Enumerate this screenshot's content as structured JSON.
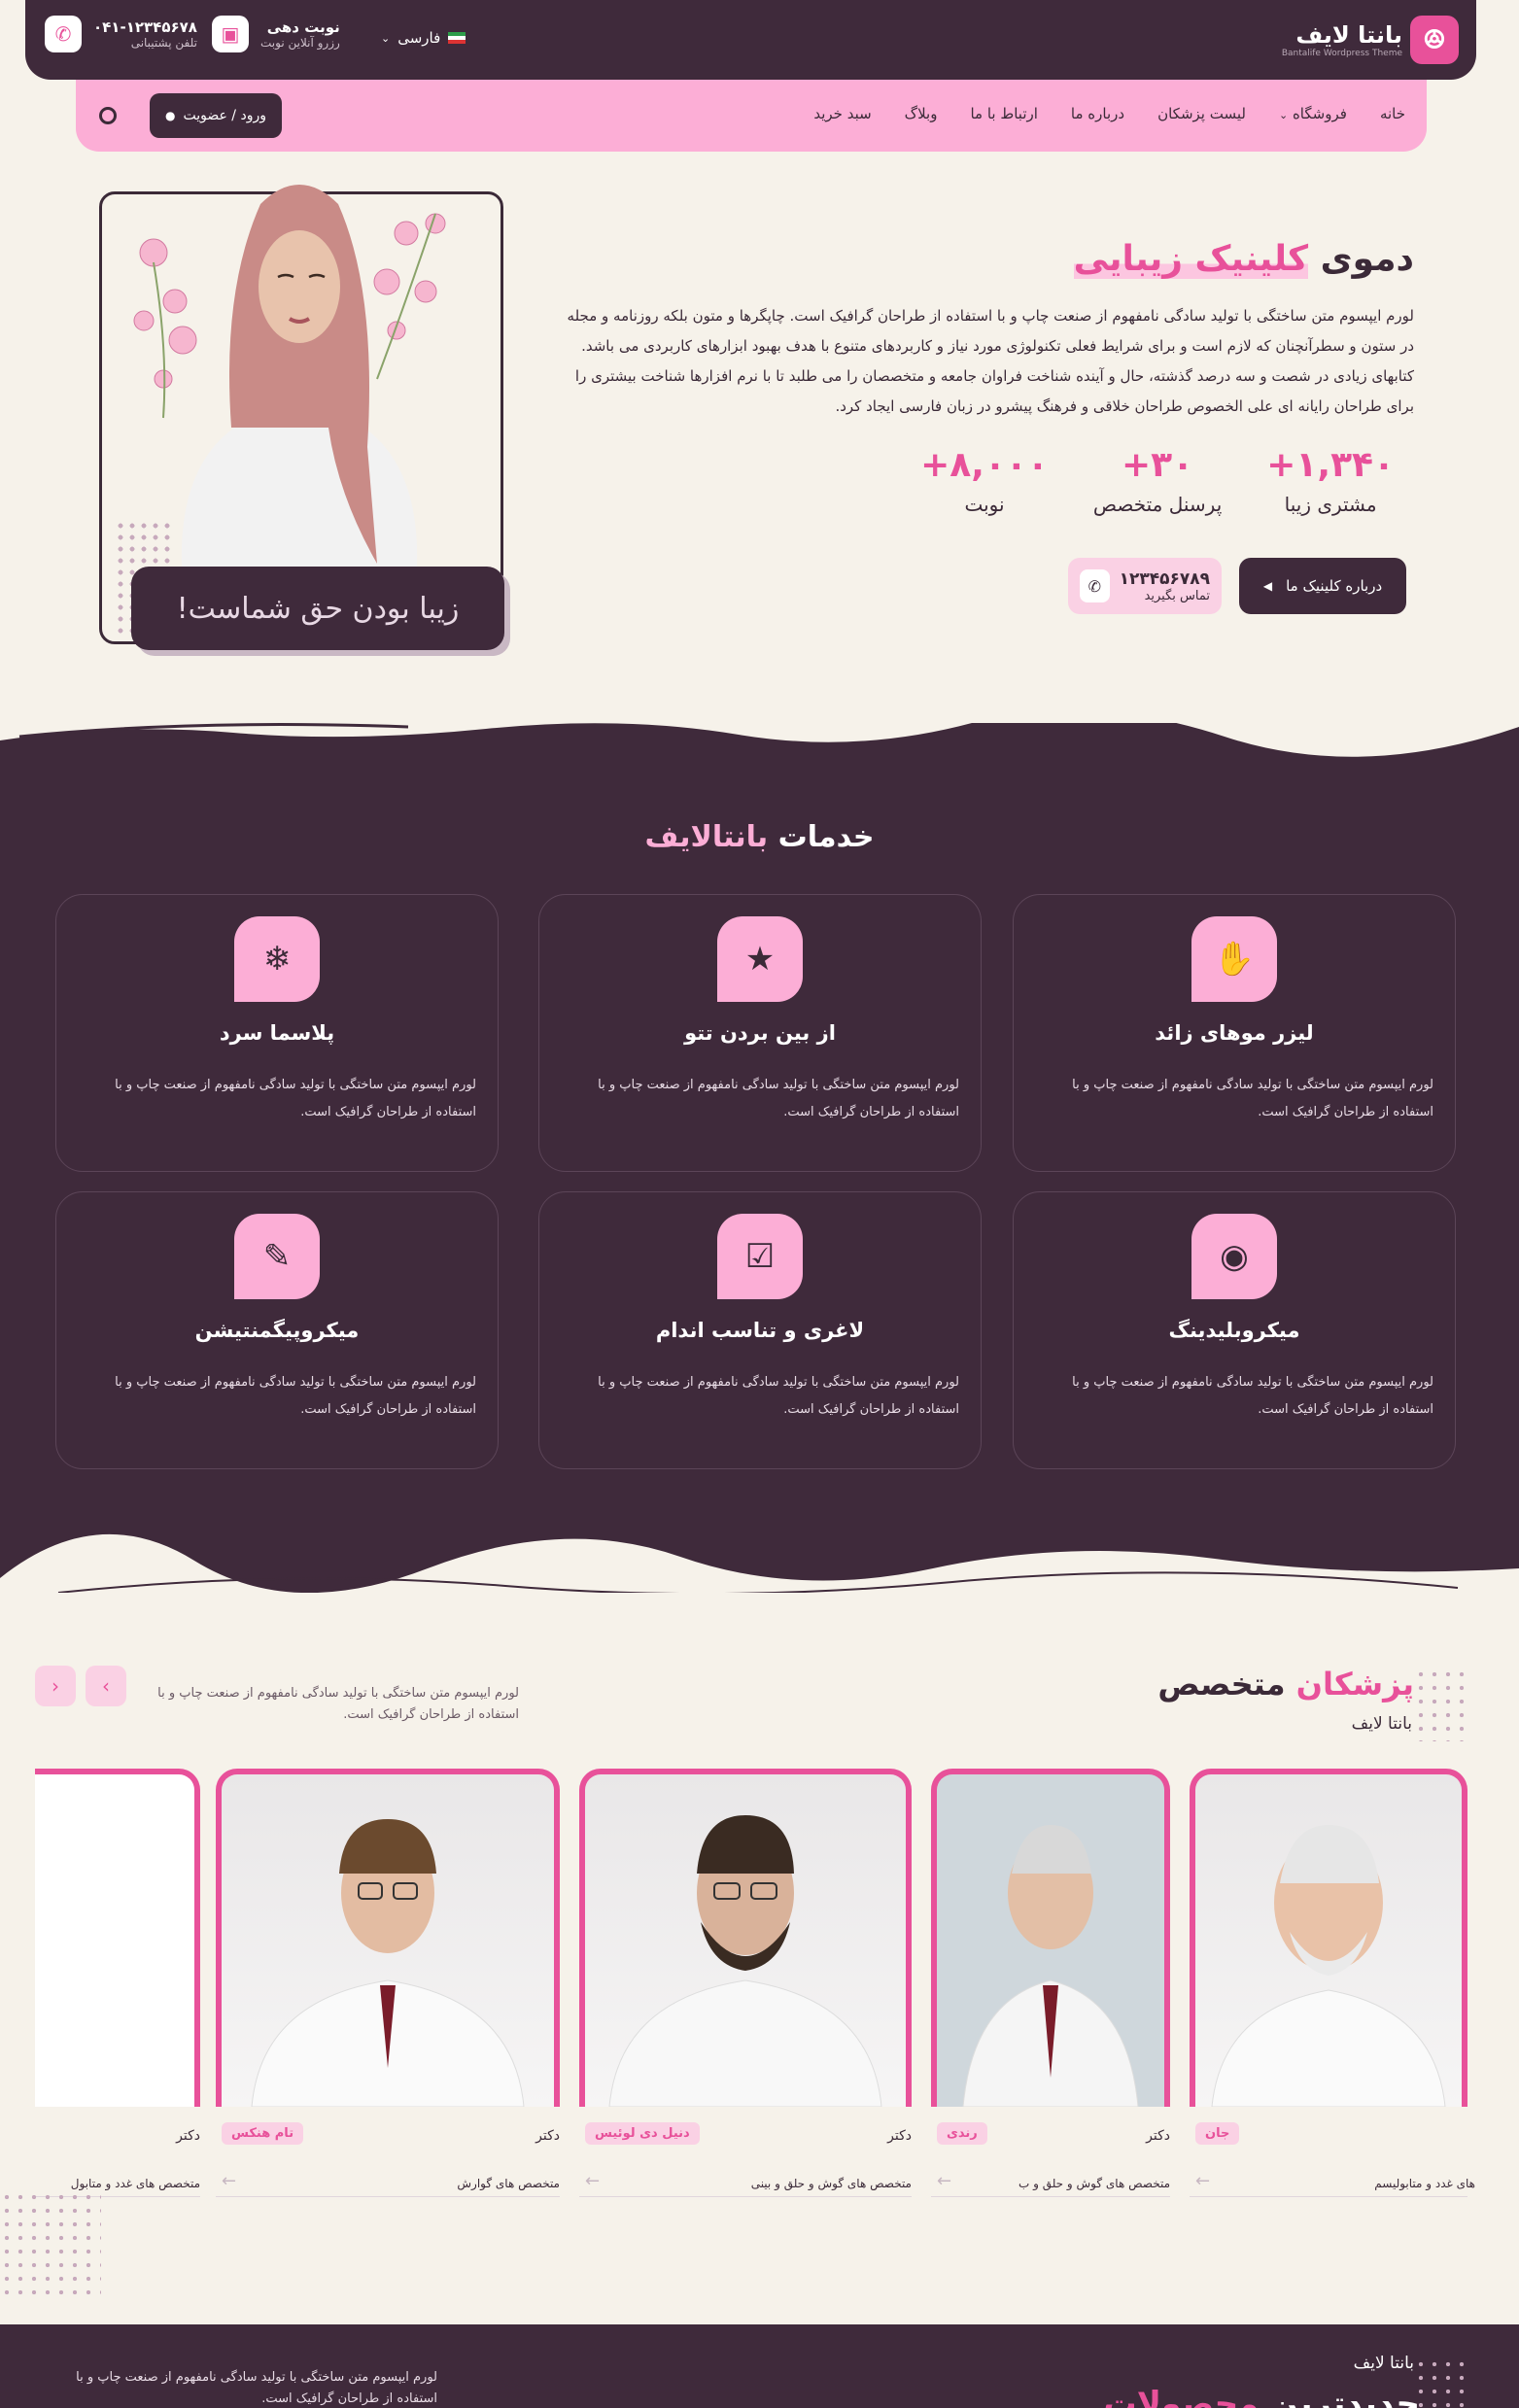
{
  "brand": {
    "name": "بانتا لایف",
    "tagline": "Bantalife Wordpress Theme",
    "accent": "#e8519a",
    "dark": "#3f2a3b",
    "pink": "#fcaed6"
  },
  "topbar": {
    "language": "فارسی",
    "booking": {
      "title": "نوبت دهی",
      "subtitle": "رزرو آنلاین نوبت"
    },
    "support": {
      "phone": "۰۴۱-۱۲۳۴۵۶۷۸",
      "subtitle": "تلفن پشتیبانی"
    }
  },
  "nav": {
    "items": [
      "خانه",
      "فروشگاه",
      "لیست پزشکان",
      "درباره ما",
      "ارتباط با ما",
      "وبلاگ",
      "سبد خرید"
    ],
    "login": "ورود / عضویت"
  },
  "hero": {
    "title_prefix": "دموی",
    "title_highlight": "کلینیک زیبایی",
    "text": "لورم ایپسوم متن ساختگی با تولید سادگی نامفهوم از صنعت چاپ و با استفاده از طراحان گرافیک است. چاپگرها و متون بلکه روزنامه و مجله در ستون و سطرآنچنان که لازم است و برای شرایط فعلی تکنولوژی مورد نیاز و کاربردهای متنوع با هدف بهبود ابزارهای کاربردی می باشد. کتابهای زیادی در شصت و سه درصد گذشته، حال و آینده شناخت فراوان جامعه و متخصصان را می طلبد تا با نرم افزارها شناخت بیشتری را برای طراحان رایانه ای علی الخصوص طراحان خلاقی و فرهنگ پیشرو در زبان فارسی ایجاد کرد.",
    "stats": [
      {
        "num": "+۱,۳۴۰",
        "label": "مشتری زیبا"
      },
      {
        "num": "+۳۰",
        "label": "پرسنل متخصص"
      },
      {
        "num": "+۸,۰۰۰",
        "label": "نوبت"
      }
    ],
    "about_button": "درباره کلینیک ما",
    "call": {
      "number": "۱۲۳۴۵۶۷۸۹",
      "label": "تماس بگیرید"
    },
    "image_caption": "زیبا بودن حق شماست!"
  },
  "services": {
    "title_prefix": "خدمات",
    "title_highlight": "بانتالایف",
    "items": [
      {
        "title": "لیزر موهای زائد",
        "icon": "hand-sparkle-icon",
        "desc": "لورم ایپسوم متن ساختگی با تولید سادگی نامفهوم از صنعت چاپ و با استفاده از طراحان گرافیک است."
      },
      {
        "title": "از بین بردن تتو",
        "icon": "star-icon",
        "desc": "لورم ایپسوم متن ساختگی با تولید سادگی نامفهوم از صنعت چاپ و با استفاده از طراحان گرافیک است."
      },
      {
        "title": "پلاسما سرد",
        "icon": "snowflake-icon",
        "desc": "لورم ایپسوم متن ساختگی با تولید سادگی نامفهوم از صنعت چاپ و با استفاده از طراحان گرافیک است."
      },
      {
        "title": "میکروبلیدینگ",
        "icon": "eye-icon",
        "desc": "لورم ایپسوم متن ساختگی با تولید سادگی نامفهوم از صنعت چاپ و با استفاده از طراحان گرافیک است."
      },
      {
        "title": "لاغری و تناسب اندام",
        "icon": "clipboard-check-icon",
        "desc": "لورم ایپسوم متن ساختگی با تولید سادگی نامفهوم از صنعت چاپ و با استفاده از طراحان گرافیک است."
      },
      {
        "title": "میکروپیگمنتیشن",
        "icon": "pencil-icon",
        "desc": "لورم ایپسوم متن ساختگی با تولید سادگی نامفهوم از صنعت چاپ و با استفاده از طراحان گرافیک است."
      }
    ]
  },
  "doctors": {
    "title_highlight": "پزشکان",
    "title_rest": "متخصص",
    "subtitle": "بانتا لایف",
    "desc": "لورم ایپسوم متن ساختگی با تولید سادگی نامفهوم از صنعت چاپ و با استفاده از طراحان گرافیک است.",
    "items": [
      {
        "role": "",
        "name": "جان",
        "spec": "های غدد و متابولیسم"
      },
      {
        "role": "دکتر",
        "name": "رندی",
        "spec": "متخصص های گوش و حلق و ب"
      },
      {
        "role": "دکتر",
        "name": "دنیل دی لوئیس",
        "spec": "متخصص های گوش و حلق و بینی"
      },
      {
        "role": "دکتر",
        "name": "تام هنکس",
        "spec": "متخصص های گوارش"
      },
      {
        "role": "دکتر",
        "name": "",
        "spec": "متخصص های غدد و متابول"
      }
    ]
  },
  "products": {
    "subtitle": "بانتا لایف",
    "title_prefix": "جدیدترین",
    "title_highlight": "محصولات",
    "desc": "لورم ایپسوم متن ساختگی با تولید سادگی نامفهوم از صنعت چاپ و با استفاده از طراحان گرافیک است."
  }
}
